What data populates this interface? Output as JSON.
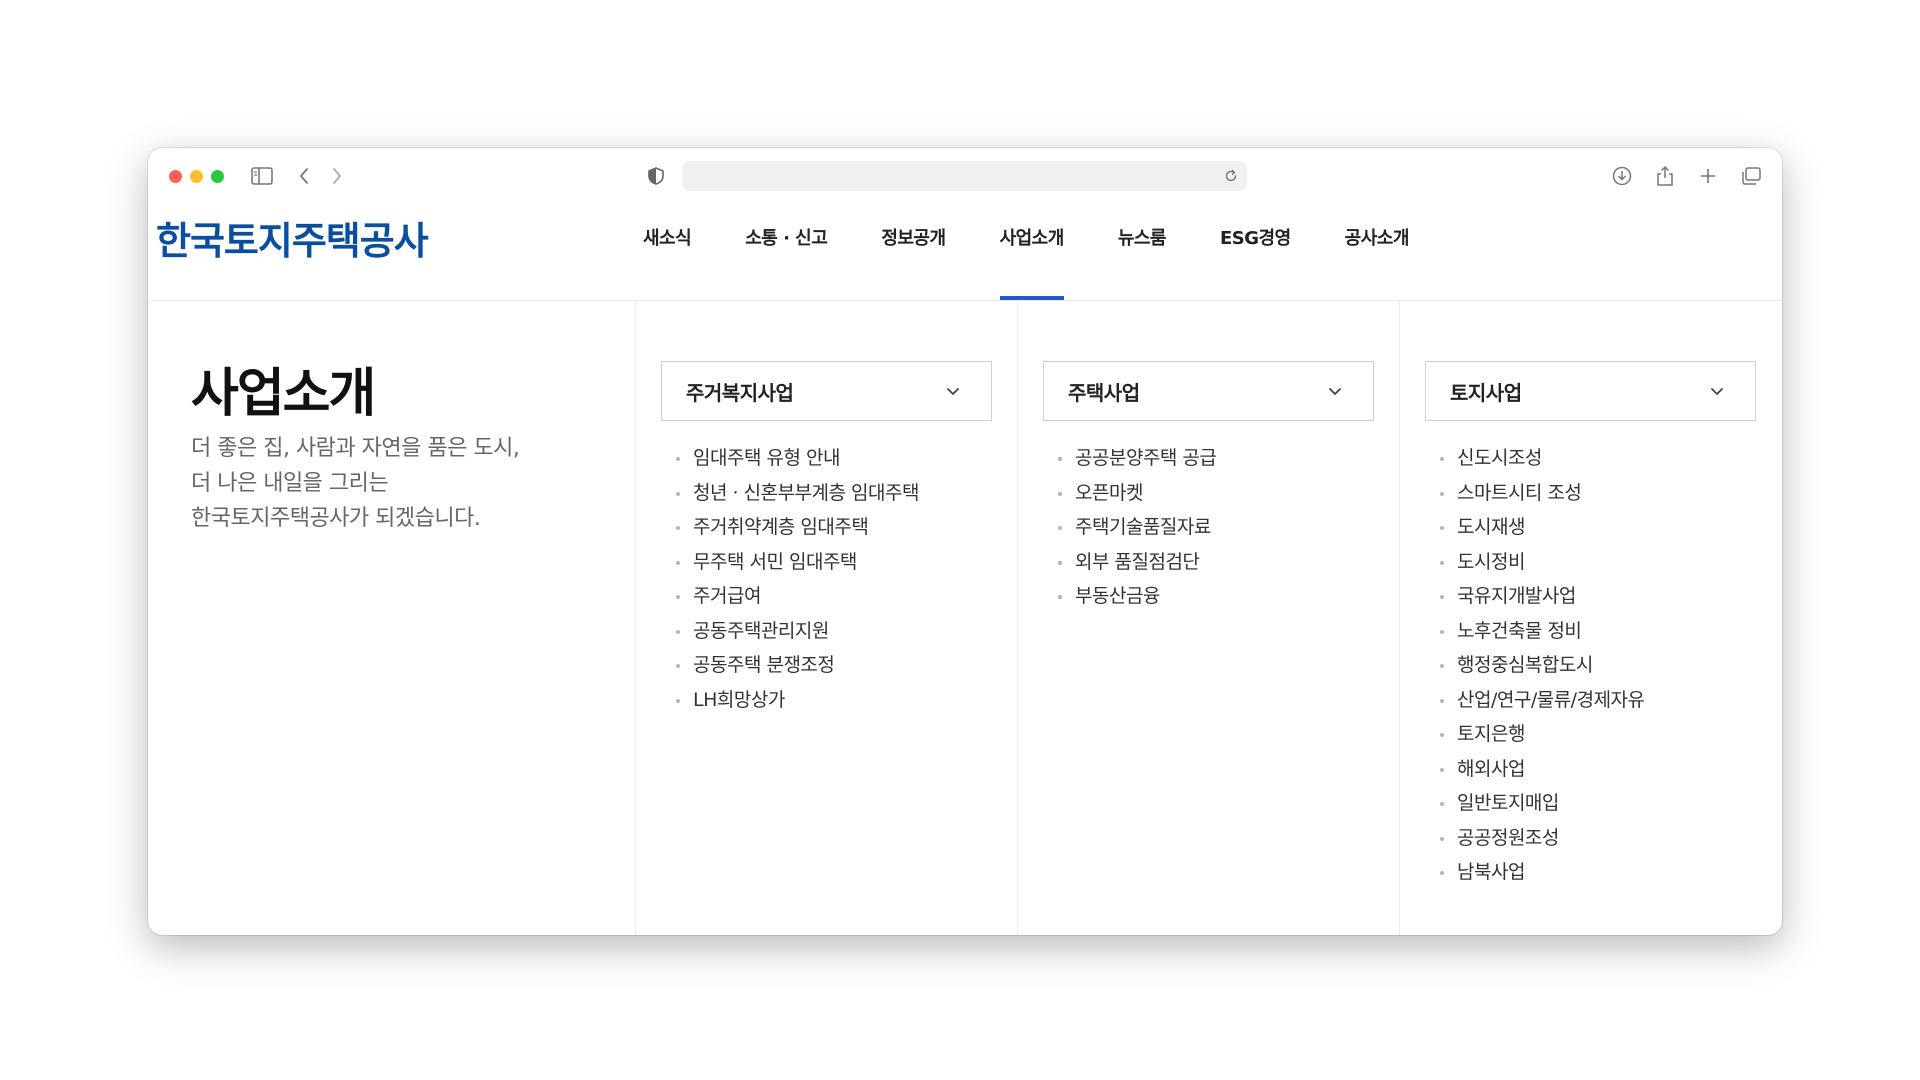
{
  "browser": {
    "address_url": ""
  },
  "site": {
    "logo": "한국토지주택공사",
    "nav": [
      {
        "label": "새소식"
      },
      {
        "label": "소통 · 신고"
      },
      {
        "label": "정보공개"
      },
      {
        "label": "사업소개",
        "active": true
      },
      {
        "label": "뉴스룸"
      },
      {
        "label": "ESG경영"
      },
      {
        "label": "공사소개"
      }
    ]
  },
  "page": {
    "title": "사업소개",
    "description": [
      "더 좋은 집, 사람과 자연을 품은 도시,",
      "더 나은 내일을 그리는",
      "한국토지주택공사가 되겠습니다."
    ]
  },
  "columns": [
    {
      "heading": "주거복지사업",
      "items": [
        "임대주택 유형 안내",
        "청년 · 신혼부부계층 임대주택",
        "주거취약계층 임대주택",
        "무주택 서민 임대주택",
        "주거급여",
        "공동주택관리지원",
        "공동주택 분쟁조정",
        "LH희망상가"
      ]
    },
    {
      "heading": "주택사업",
      "items": [
        "공공분양주택 공급",
        "오픈마켓",
        "주택기술품질자료",
        "외부 품질점검단",
        "부동산금융"
      ]
    },
    {
      "heading": "토지사업",
      "items": [
        "신도시조성",
        "스마트시티 조성",
        "도시재생",
        "도시정비",
        "국유지개발사업",
        "노후건축물 정비",
        "행정중심복합도시",
        "산업/연구/물류/경제자유",
        "토지은행",
        "해외사업",
        "일반토지매입",
        "공공정원조성",
        "남북사업"
      ]
    }
  ],
  "colors": {
    "brand": "#0a4ea0",
    "nav_active_bar": "#2159c9"
  }
}
